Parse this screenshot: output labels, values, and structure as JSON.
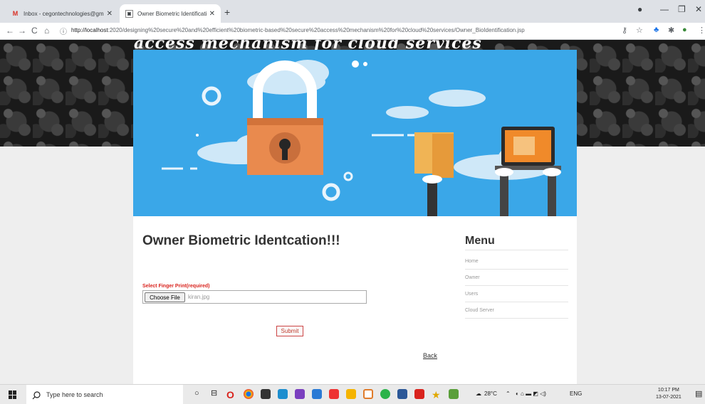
{
  "browser": {
    "tabs": [
      {
        "label": "Inbox - cegontechnologies@gm",
        "icon": "gmail-icon"
      },
      {
        "label": "Owner Biometric Identification",
        "icon": "page-icon"
      }
    ],
    "url_host": "http://localhost",
    "url_rest": ":2020/designing%20secure%20and%20efficient%20biometric-based%20secure%20access%20mechanism%20for%20cloud%20services/Owner_BioIdentification.jsp"
  },
  "site": {
    "title": "access mechanism for cloud services"
  },
  "main": {
    "heading": "Owner Biometric Identcation!!!",
    "field_label": "Select Finger Print(required)",
    "choose_file_label": "Choose File",
    "file_name": "kiran.jpg",
    "submit_label": "Submit",
    "back_label": "Back"
  },
  "menu": {
    "title": "Menu",
    "items": [
      "Home",
      "Owner",
      "Users",
      "Cloud Server"
    ]
  },
  "taskbar": {
    "search_placeholder": "Type here to search",
    "weather": "28°C",
    "language": "ENG",
    "time": "10:17 PM",
    "date": "13-07-2021"
  }
}
